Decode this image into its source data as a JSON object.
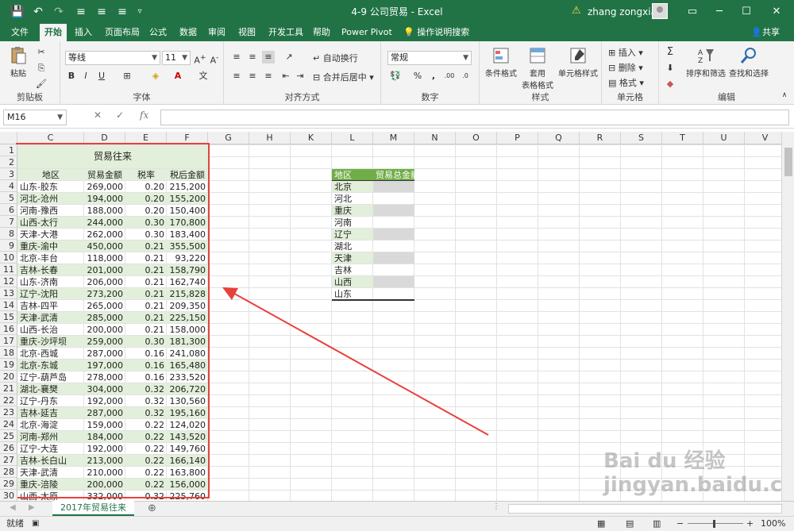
{
  "window": {
    "title": "4-9 公司贸易 - Excel",
    "user": "zhang zongxian",
    "accent": "#217346"
  },
  "tabs": [
    "文件",
    "开始",
    "插入",
    "页面布局",
    "公式",
    "数据",
    "审阅",
    "视图",
    "开发工具",
    "帮助",
    "Power Pivot"
  ],
  "active_tab": "开始",
  "tell_me": "操作说明搜索",
  "share": "共享",
  "ribbon": {
    "paste": "粘贴",
    "font_name": "等线",
    "font_size": "11",
    "wrap_text": "自动换行",
    "merge_center": "合并后居中",
    "number_format": "常规",
    "conditional_format": "条件格式",
    "table_format_1": "套用",
    "table_format_2": "表格格式",
    "cell_style": "单元格样式",
    "insert": "插入",
    "delete": "删除",
    "format": "格式",
    "sort_filter": "排序和筛选",
    "find_select": "查找和选择",
    "groups": [
      "剪贴板",
      "字体",
      "对齐方式",
      "数字",
      "样式",
      "单元格",
      "编辑"
    ]
  },
  "formula_bar": {
    "name_box": "M16",
    "formula": "",
    "fx": "fx"
  },
  "columns": [
    "C",
    "D",
    "E",
    "F",
    "G",
    "H",
    "K",
    "L",
    "M",
    "N",
    "O",
    "P",
    "Q",
    "R",
    "S",
    "T",
    "U",
    "V"
  ],
  "rows": [
    "1",
    "2",
    "3",
    "4",
    "5",
    "6",
    "7",
    "8",
    "9",
    "10",
    "11",
    "12",
    "13",
    "14",
    "15",
    "16",
    "17",
    "18",
    "19",
    "20",
    "21",
    "22",
    "23",
    "24",
    "25",
    "26",
    "27",
    "28",
    "29",
    "30"
  ],
  "trade_table": {
    "title": "贸易往来",
    "headers": [
      "地区",
      "贸易金额",
      "税率",
      "税后金额"
    ],
    "rows": [
      [
        "山东-胶东",
        "269,000",
        "0.20",
        "215,200"
      ],
      [
        "河北-沧州",
        "194,000",
        "0.20",
        "155,200"
      ],
      [
        "河南-豫西",
        "188,000",
        "0.20",
        "150,400"
      ],
      [
        "山西-太行",
        "244,000",
        "0.30",
        "170,800"
      ],
      [
        "天津-大港",
        "262,000",
        "0.30",
        "183,400"
      ],
      [
        "重庆-渝中",
        "450,000",
        "0.21",
        "355,500"
      ],
      [
        "北京-丰台",
        "118,000",
        "0.21",
        "93,220"
      ],
      [
        "吉林-长春",
        "201,000",
        "0.21",
        "158,790"
      ],
      [
        "山东-济南",
        "206,000",
        "0.21",
        "162,740"
      ],
      [
        "辽宁-沈阳",
        "273,200",
        "0.21",
        "215,828"
      ],
      [
        "吉林-四平",
        "265,000",
        "0.21",
        "209,350"
      ],
      [
        "天津-武清",
        "285,000",
        "0.21",
        "225,150"
      ],
      [
        "山西-长治",
        "200,000",
        "0.21",
        "158,000"
      ],
      [
        "重庆-沙坪坝",
        "259,000",
        "0.30",
        "181,300"
      ],
      [
        "北京-西城",
        "287,000",
        "0.16",
        "241,080"
      ],
      [
        "北京-东城",
        "197,000",
        "0.16",
        "165,480"
      ],
      [
        "辽宁-葫芦岛",
        "278,000",
        "0.16",
        "233,520"
      ],
      [
        "湖北-襄樊",
        "304,000",
        "0.32",
        "206,720"
      ],
      [
        "辽宁-丹东",
        "192,000",
        "0.32",
        "130,560"
      ],
      [
        "吉林-延吉",
        "287,000",
        "0.32",
        "195,160"
      ],
      [
        "北京-海淀",
        "159,000",
        "0.22",
        "124,020"
      ],
      [
        "河南-郑州",
        "184,000",
        "0.22",
        "143,520"
      ],
      [
        "辽宁-大连",
        "192,000",
        "0.22",
        "149,760"
      ],
      [
        "吉林-长白山",
        "213,000",
        "0.22",
        "166,140"
      ],
      [
        "天津-武清",
        "210,000",
        "0.22",
        "163,800"
      ],
      [
        "重庆-涪陵",
        "200,000",
        "0.22",
        "156,000"
      ],
      [
        "山西-太原",
        "332,000",
        "0.32",
        "225,760"
      ]
    ]
  },
  "summary_table": {
    "headers": [
      "地区",
      "贸易总金额"
    ],
    "regions": [
      "北京",
      "河北",
      "重庆",
      "河南",
      "辽宁",
      "湖北",
      "天津",
      "吉林",
      "山西",
      "山东"
    ]
  },
  "sheet_tab": "2017年贸易往来",
  "status": {
    "ready": "就绪",
    "zoom": "100%"
  },
  "watermark": "Bai du 经验 jingyan.baidu.com"
}
